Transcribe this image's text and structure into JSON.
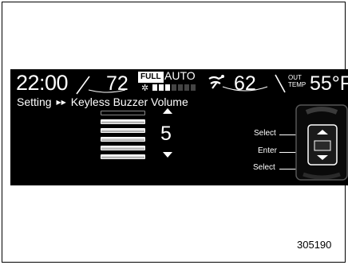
{
  "status_bar": {
    "time": "22:00",
    "driver_temp": "72",
    "fan_mode_badge": "FULL",
    "fan_mode": "AUTO",
    "fan_level": 3,
    "fan_level_max": 7,
    "passenger_temp": "62",
    "outside_temp_label_line1": "OUT",
    "outside_temp_label_line2": "TEMP",
    "outside_temp": "55°F"
  },
  "breadcrumb": {
    "root": "Setting",
    "separator": "▶▶",
    "current": "Keyless Buzzer Volume"
  },
  "volume": {
    "value": "5",
    "level": 5,
    "level_max": 6
  },
  "callouts": {
    "select_up": "Select",
    "enter": "Enter",
    "select_down": "Select"
  },
  "figure_id": "305190",
  "icons": [
    "fan-icon",
    "airflow-icon",
    "up-arrow-icon",
    "down-arrow-icon",
    "steering-switch-icon"
  ]
}
